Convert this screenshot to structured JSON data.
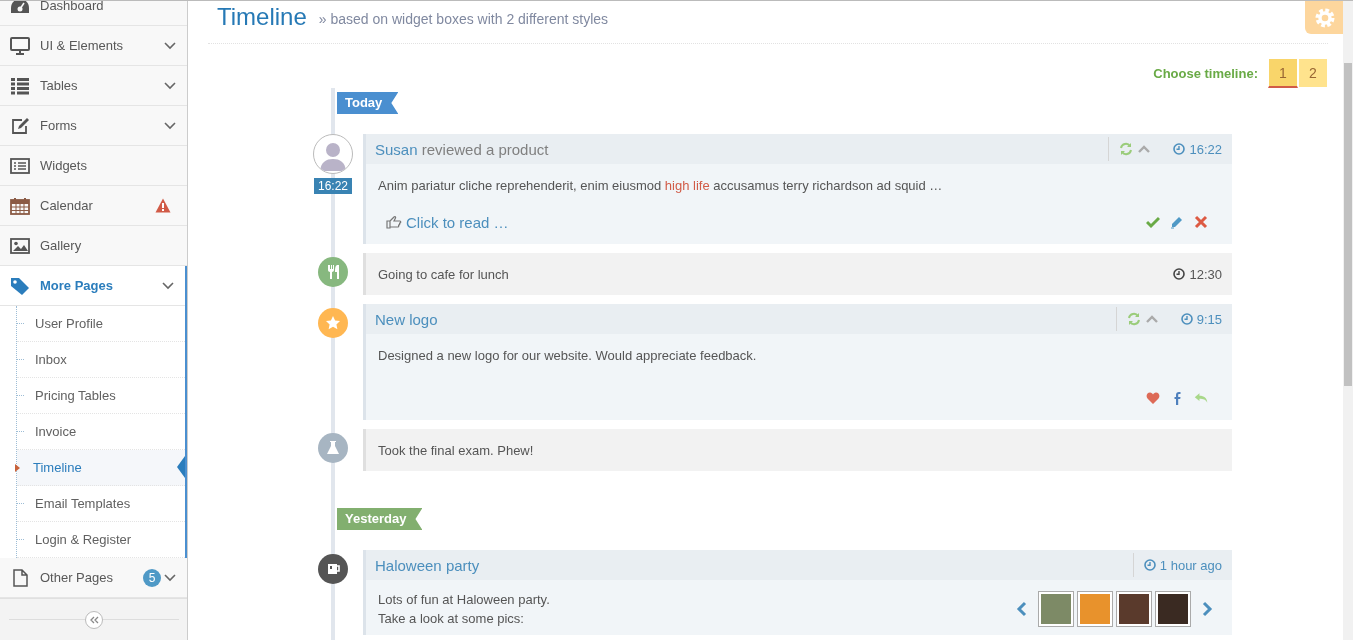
{
  "sidebar": {
    "items": [
      {
        "label": "Dashboard",
        "has_submenu": false,
        "alert": false,
        "selected": false,
        "expanded": false
      },
      {
        "label": "UI & Elements",
        "has_submenu": true,
        "alert": false,
        "selected": false,
        "expanded": false
      },
      {
        "label": "Tables",
        "has_submenu": true,
        "alert": false,
        "selected": false,
        "expanded": false
      },
      {
        "label": "Forms",
        "has_submenu": true,
        "alert": false,
        "selected": false,
        "expanded": false
      },
      {
        "label": "Widgets",
        "has_submenu": false,
        "alert": false,
        "selected": false,
        "expanded": false
      },
      {
        "label": "Calendar",
        "has_submenu": false,
        "alert": true,
        "selected": false,
        "expanded": false
      },
      {
        "label": "Gallery",
        "has_submenu": false,
        "alert": false,
        "selected": false,
        "expanded": false
      },
      {
        "label": "More Pages",
        "has_submenu": true,
        "alert": false,
        "selected": true,
        "expanded": true,
        "children": [
          {
            "label": "User Profile",
            "selected": false
          },
          {
            "label": "Inbox",
            "selected": false
          },
          {
            "label": "Pricing Tables",
            "selected": false
          },
          {
            "label": "Invoice",
            "selected": false
          },
          {
            "label": "Timeline",
            "selected": true
          },
          {
            "label": "Email Templates",
            "selected": false
          },
          {
            "label": "Login & Register",
            "selected": false
          }
        ]
      },
      {
        "label": "Other Pages",
        "has_submenu": true,
        "alert": false,
        "selected": false,
        "expanded": false,
        "badge": "5"
      }
    ]
  },
  "header": {
    "title": "Timeline",
    "subtitle": "» based on widget boxes with 2 different styles"
  },
  "switcher": {
    "label": "Choose timeline:",
    "options": [
      {
        "label": "1",
        "selected": true
      },
      {
        "label": "2",
        "selected": false
      }
    ]
  },
  "groups": [
    {
      "label": "Today",
      "color": "#4a8fd0",
      "items": [
        {
          "kind": "widget",
          "avatar": true,
          "badge": "16:22",
          "tools": true,
          "time": "16:22",
          "footer": {
            "kind": "moderation",
            "link": "Click to read …"
          },
          "title": [
            {
              "text": "Susan",
              "link": true
            },
            {
              "text": " reviewed a product",
              "link": false
            }
          ],
          "body": [
            [
              {
                "text": "Anim pariatur cliche reprehenderit, enim eiusmod ",
                "highlight": false
              },
              {
                "text": "high life",
                "highlight": true
              },
              {
                "text": " accusamus terry richardson ad squid …",
                "highlight": false
              }
            ]
          ]
        },
        {
          "kind": "simple",
          "avatar": false,
          "color": "#87b87f",
          "text": "Going to cafe for lunch",
          "time": "12:30"
        },
        {
          "kind": "widget",
          "avatar": false,
          "color": "#ffb752",
          "tools": true,
          "time": "9:15",
          "footer": {
            "kind": "social"
          },
          "title": [
            {
              "text": "New logo",
              "link": true
            }
          ],
          "body": [
            [
              {
                "text": "Designed a new logo for our website. Would appreciate feedback.",
                "highlight": false
              }
            ]
          ]
        },
        {
          "kind": "simple",
          "avatar": false,
          "color": "#a7b5c2",
          "text": "Took the final exam. Phew!"
        }
      ]
    },
    {
      "label": "Yesterday",
      "color": "#82af6f",
      "items": [
        {
          "kind": "widget",
          "avatar": false,
          "color": "#555555",
          "tools": false,
          "time": "1 hour ago",
          "title": [
            {
              "text": "Haloween party",
              "link": true
            }
          ],
          "body": [
            [
              {
                "text": "Lots of fun at Haloween party.",
                "highlight": false
              }
            ],
            [
              {
                "text": "Take a look at some pics:",
                "highlight": false
              }
            ]
          ],
          "footer": {
            "kind": "gallery",
            "photos": [
              {
                "color": "#7d8a66"
              },
              {
                "color": "#e8922c"
              },
              {
                "color": "#5a3a2c"
              },
              {
                "color": "#3a2a22"
              }
            ]
          }
        }
      ]
    }
  ]
}
